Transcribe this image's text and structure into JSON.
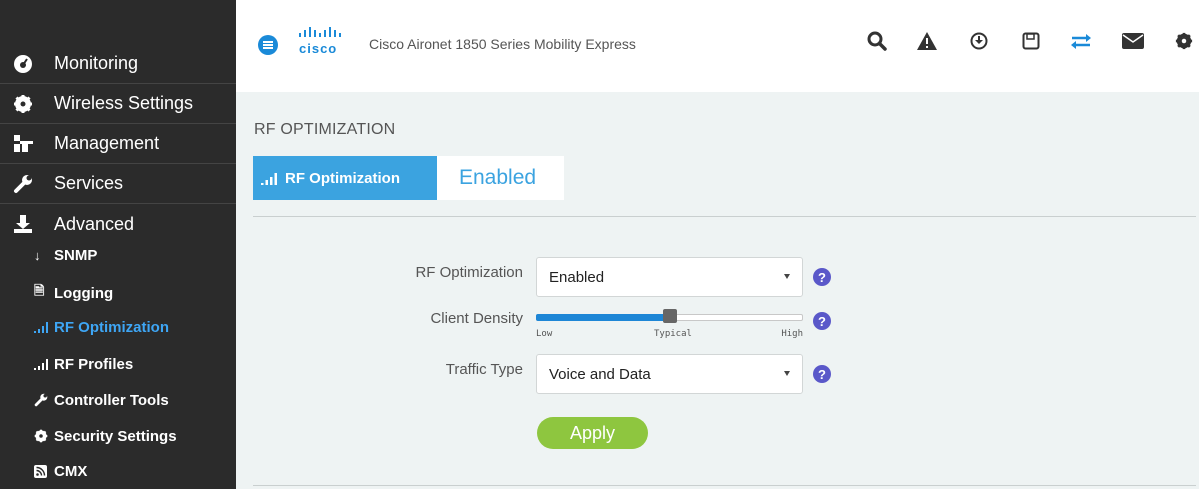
{
  "sidebar": {
    "items": [
      {
        "label": "Monitoring",
        "icon": "dashboard-icon"
      },
      {
        "label": "Wireless Settings",
        "icon": "gear-icon"
      },
      {
        "label": "Management",
        "icon": "sitemap-icon"
      },
      {
        "label": "Services",
        "icon": "wrench-icon"
      },
      {
        "label": "Advanced",
        "icon": "download-icon"
      }
    ],
    "subitems": [
      {
        "label": "SNMP",
        "icon": "arrow-down-icon",
        "active": false
      },
      {
        "label": "Logging",
        "icon": "document-icon",
        "active": false
      },
      {
        "label": "RF Optimization",
        "icon": "signal-bars-icon",
        "active": true
      },
      {
        "label": "RF Profiles",
        "icon": "signal-bars-icon",
        "active": false
      },
      {
        "label": "Controller Tools",
        "icon": "wrench-icon",
        "active": false
      },
      {
        "label": "Security Settings",
        "icon": "gear-icon",
        "active": false
      },
      {
        "label": "CMX",
        "icon": "rss-icon",
        "active": false
      }
    ]
  },
  "header": {
    "logo_text": "cisco",
    "title": "Cisco Aironet 1850 Series Mobility Express",
    "icons": [
      "search-icon",
      "warning-icon",
      "download-circle-icon",
      "save-icon",
      "transfer-icon",
      "mail-icon",
      "settings-icon"
    ],
    "accent": "#1a8ad8"
  },
  "main": {
    "section_title": "RF OPTIMIZATION",
    "tab_label": "RF Optimization",
    "tab_status": "Enabled",
    "form": {
      "rf_optimization_label": "RF Optimization",
      "rf_optimization_value": "Enabled",
      "client_density_label": "Client Density",
      "client_density_ticks": [
        "Low",
        "Typical",
        "High"
      ],
      "client_density_level": 0.5,
      "traffic_type_label": "Traffic Type",
      "traffic_type_value": "Voice and Data",
      "help_glyph": "?",
      "apply_label": "Apply"
    }
  }
}
